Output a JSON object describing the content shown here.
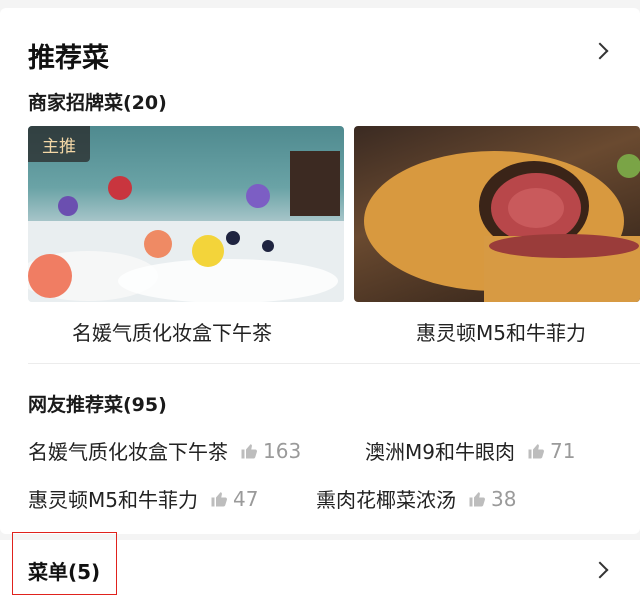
{
  "section": {
    "title": "推荐菜",
    "merchant_title": "商家招牌菜(20)",
    "featured": [
      {
        "badge": "主推",
        "caption": "名媛气质化妆盒下午茶"
      },
      {
        "badge": "",
        "caption": "惠灵顿M5和牛菲力"
      }
    ],
    "netizen_title": "网友推荐菜(95)",
    "netizen_items": [
      {
        "name": "名媛气质化妆盒下午茶",
        "likes": "163"
      },
      {
        "name": "澳洲M9和牛眼肉",
        "likes": "71"
      },
      {
        "name": "惠灵顿M5和牛菲力",
        "likes": "47"
      },
      {
        "name": "熏肉花椰菜浓汤",
        "likes": "38"
      }
    ]
  },
  "menu": {
    "label": "菜单(5)"
  },
  "colors": {
    "highlight_border": "#e0221d",
    "badge_text": "#f3d7a6"
  },
  "icons": {
    "like": "thumbs-up-icon",
    "more": "chevron-right-icon"
  }
}
